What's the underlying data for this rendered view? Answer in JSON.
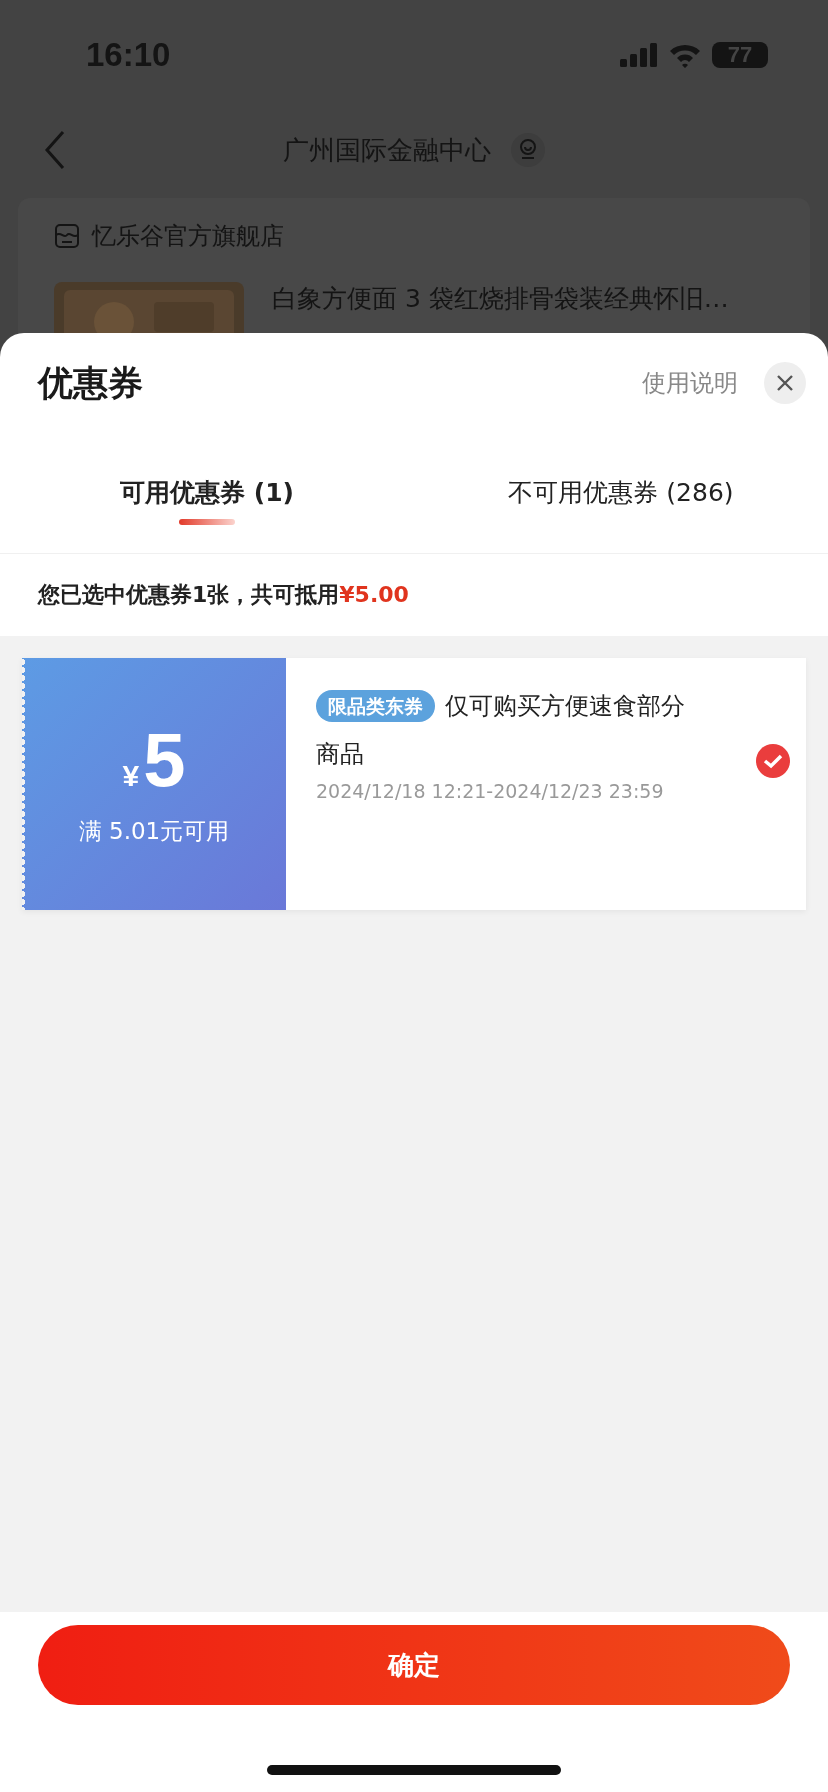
{
  "status_bar": {
    "time": "16:10",
    "battery": "77"
  },
  "nav": {
    "title": "广州国际金融中心"
  },
  "store": {
    "name": "忆乐谷官方旗舰店",
    "product_title": "白象方便面 3 袋红烧排骨袋装经典怀旧…"
  },
  "sheet": {
    "title": "优惠券",
    "help_link": "使用说明"
  },
  "tabs": [
    {
      "label": "可用优惠券 (1)",
      "selected": true
    },
    {
      "label": "不可用优惠券 (286)",
      "selected": false
    }
  ],
  "summary": {
    "text": "您已选中优惠券1张，共可抵用",
    "amount": "¥5.00"
  },
  "coupons": [
    {
      "currency": "¥",
      "amount": "5",
      "condition": "满 5.01元可用",
      "tag": "限品类东券",
      "description_lines": [
        "仅可购买方便速食部分",
        "商品"
      ],
      "validity": "2024/12/18 12:21-2024/12/23 23:59",
      "selected": true
    }
  ],
  "confirm_button": "确定"
}
